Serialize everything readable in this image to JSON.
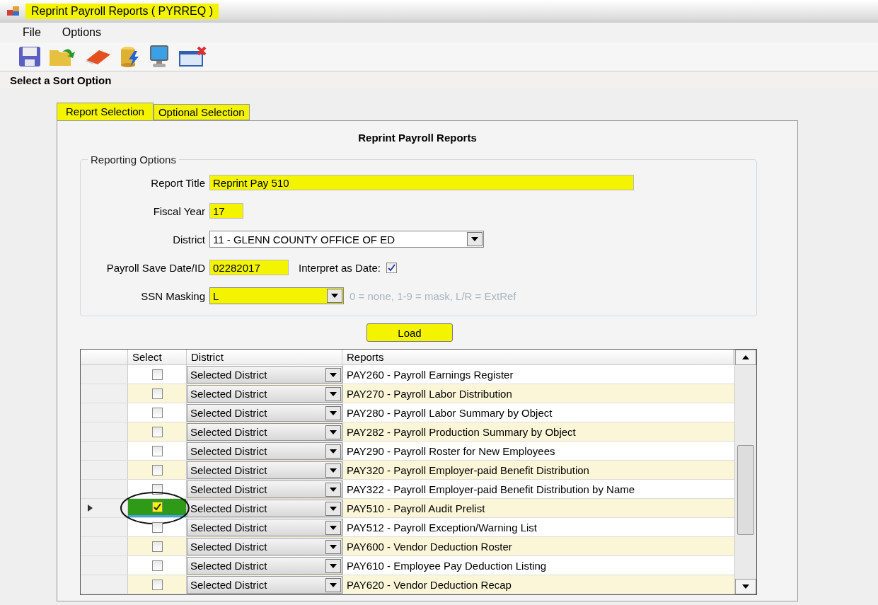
{
  "window": {
    "title": "Reprint Payroll Reports ( PYRREQ )",
    "highlighted": true
  },
  "menu": [
    "File",
    "Options"
  ],
  "section_label": "Select a Sort Option",
  "tabs": [
    {
      "label": "Report Selection",
      "selected": true,
      "highlighted": true
    },
    {
      "label": "Optional Selection",
      "selected": false,
      "highlighted": true
    }
  ],
  "heading": "Reprint Payroll Reports",
  "group": {
    "title": "Reporting Options",
    "fields": [
      {
        "kind": "text",
        "label": "Report Title",
        "value": "Reprint Pay 510",
        "highlighted": true
      },
      {
        "kind": "short",
        "label": "Fiscal Year",
        "value": "17",
        "highlighted": true
      },
      {
        "kind": "select",
        "label": "District",
        "value": "11 - GLENN COUNTY OFFICE OF ED",
        "highlighted": false
      },
      {
        "kind": "date",
        "label": "Payroll Save Date/ID",
        "value": "02282017",
        "highlighted": true,
        "check_label": "Interpret as Date:",
        "checked": true
      },
      {
        "kind": "mask",
        "label": "SSN Masking",
        "value": "L",
        "highlighted": true,
        "hint": "0 = none, 1-9 = mask, L/R = ExtRef"
      }
    ]
  },
  "load_button": {
    "label": "Load",
    "highlighted": true
  },
  "table": {
    "columns": [
      "Select",
      "District",
      "Reports"
    ],
    "rows": [
      {
        "checked": false,
        "selected": false,
        "district": "Selected District",
        "report": "PAY260 - Payroll Earnings Register"
      },
      {
        "checked": false,
        "selected": false,
        "district": "Selected District",
        "report": "PAY270 - Payroll Labor Distribution"
      },
      {
        "checked": false,
        "selected": false,
        "district": "Selected District",
        "report": "PAY280 - Payroll Labor Summary by Object"
      },
      {
        "checked": false,
        "selected": false,
        "district": "Selected District",
        "report": "PAY282 - Payroll Production Summary by Object"
      },
      {
        "checked": false,
        "selected": false,
        "district": "Selected District",
        "report": "PAY290 - Payroll Roster for New Employees"
      },
      {
        "checked": false,
        "selected": false,
        "district": "Selected District",
        "report": "PAY320 - Payroll Employer-paid Benefit Distribution"
      },
      {
        "checked": false,
        "selected": false,
        "district": "Selected District",
        "report": "PAY322 - Payroll Employer-paid Benefit Distribution by Name"
      },
      {
        "checked": true,
        "selected": true,
        "district": "Selected District",
        "report": "PAY510 - Payroll Audit Prelist"
      },
      {
        "checked": false,
        "selected": false,
        "district": "Selected District",
        "report": "PAY512 - Payroll Exception/Warning List"
      },
      {
        "checked": false,
        "selected": false,
        "district": "Selected District",
        "report": "PAY600 - Vendor Deduction Roster"
      },
      {
        "checked": false,
        "selected": false,
        "district": "Selected District",
        "report": "PAY610 - Employee Pay Deduction Listing"
      },
      {
        "checked": false,
        "selected": false,
        "district": "Selected District",
        "report": "PAY620 - Vendor Deduction Recap"
      }
    ]
  }
}
